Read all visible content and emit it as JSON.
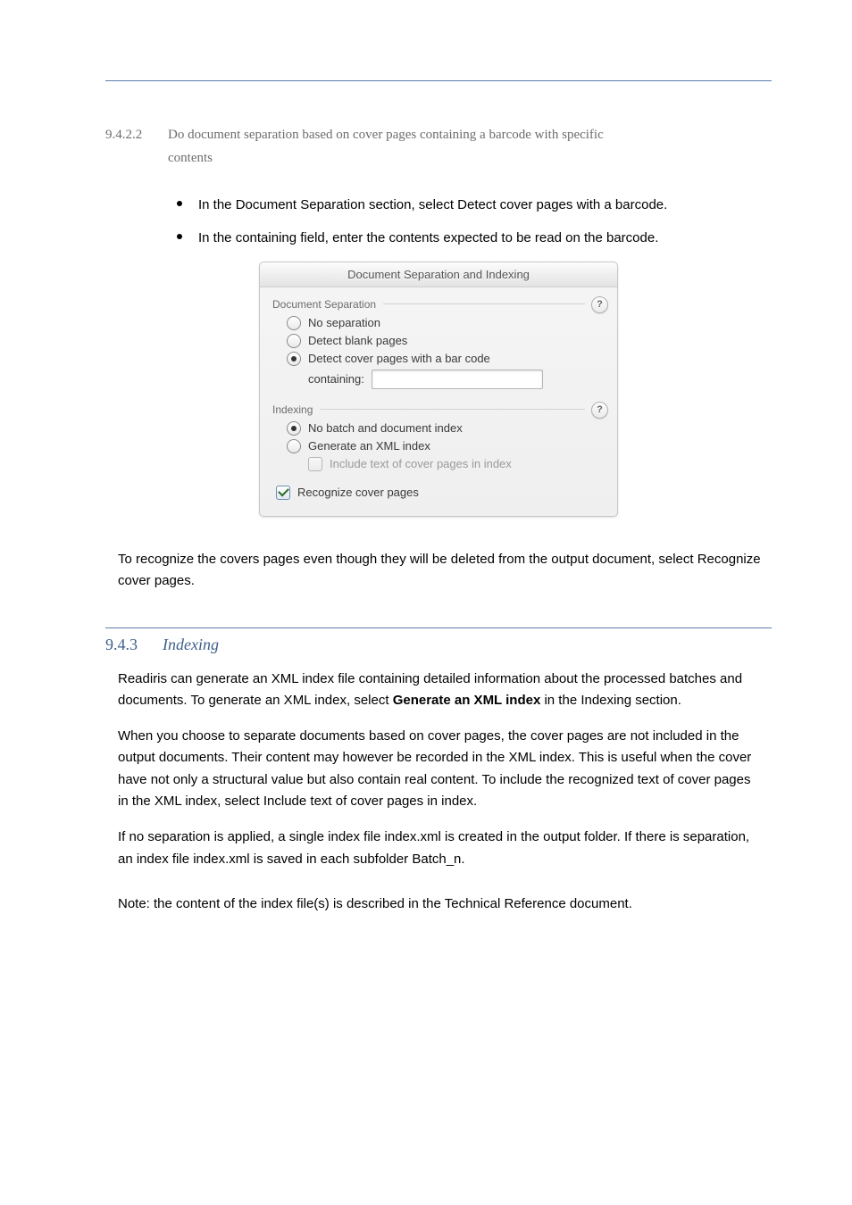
{
  "heading": {
    "number": "9.4.2.2",
    "text_line1": "Do document separation based on cover pages containing a barcode with specific",
    "text_line2": "contents"
  },
  "bullets": {
    "b1": "In the Document Separation section, select Detect cover pages with a barcode.",
    "b2": "In the containing field, enter the contents expected to be read on the barcode."
  },
  "dialog": {
    "title": "Document Separation and Indexing",
    "sep_label": "Document Separation",
    "no_sep": "No separation",
    "blank": "Detect blank pages",
    "barcode": "Detect cover pages with a bar code",
    "containing": "containing:",
    "idx_label": "Indexing",
    "no_idx": "No batch and document index",
    "xml": "Generate an XML index",
    "include": "Include text of cover pages in index",
    "recognize": "Recognize cover pages",
    "help": "?"
  },
  "after_shot": "To recognize the covers pages even though they will be deleted from the output document, select Recognize cover pages.",
  "section": {
    "number": "9.4.3",
    "title": "Indexing"
  },
  "p1": {
    "a": "Readiris can generate an XML index file containing detailed information about the processed batches and documents. To generate an XML index, select ",
    "b": "Generate an XML index",
    "c": " in the Indexing section."
  },
  "p2": "When you choose to separate documents based on cover pages, the cover pages are not included in the output documents. Their content may however be recorded in the XML index. This is useful when the cover have not only a structural value but also contain real content. To include the recognized text of cover pages in the XML index, select Include text of cover pages in index.",
  "p3": "If no separation is applied, a single index file index.xml is created in the output folder. If there is separation, an index file index.xml is saved in each subfolder Batch_n.",
  "p4": "Note: the content of the index file(s) is described in the Technical Reference document."
}
